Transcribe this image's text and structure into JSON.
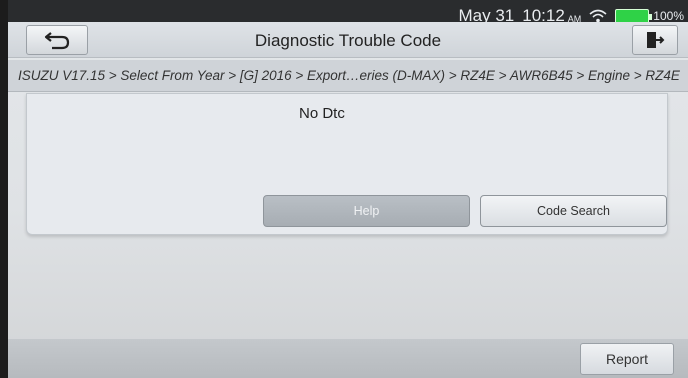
{
  "status": {
    "date": "May 31",
    "time": "10:12",
    "ampm": "AM",
    "battery": "100%"
  },
  "header": {
    "title": "Diagnostic Trouble Code"
  },
  "breadcrumb": "ISUZU V17.15 > Select From Year > [G] 2016 > Export…eries (D-MAX) > RZ4E > AWR6B45 > Engine > RZ4E",
  "panel": {
    "message": "No Dtc",
    "help_label": "Help",
    "code_search_label": "Code Search"
  },
  "footer": {
    "report_label": "Report"
  },
  "colors": {
    "battery": "#2fd247",
    "status_bar": "#2a2c2e"
  }
}
